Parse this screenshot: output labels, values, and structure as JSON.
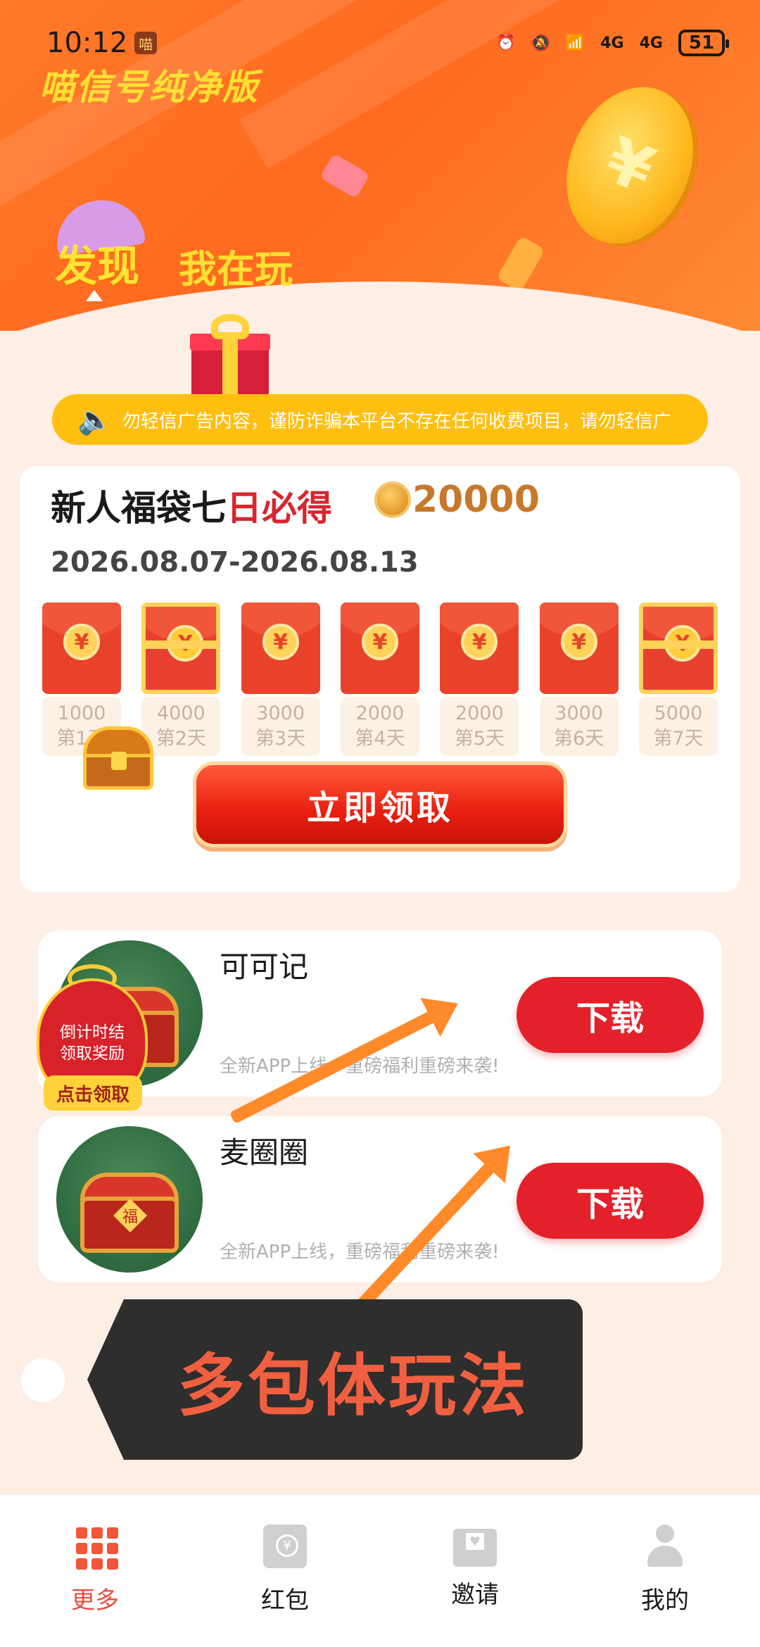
{
  "status_bar": {
    "time": "10:12",
    "signal_labels": [
      "4G",
      "4G"
    ],
    "battery": "51"
  },
  "app": {
    "title": "喵信号纯净版"
  },
  "tabs": [
    {
      "label": "发现",
      "active": true
    },
    {
      "label": "我在玩",
      "active": false
    }
  ],
  "notice": {
    "text": "勿轻信广告内容，谨防诈骗本平台不存在任何收费项目，请勿轻信广"
  },
  "welfare": {
    "title_black": "新人福袋七",
    "title_red": "日必得",
    "reward": "20000",
    "date_range": "2026.08.07-2026.08.13",
    "days": [
      {
        "amount": "1000",
        "label": "第1天",
        "special": false
      },
      {
        "amount": "4000",
        "label": "第2天",
        "special": true
      },
      {
        "amount": "3000",
        "label": "第3天",
        "special": false
      },
      {
        "amount": "2000",
        "label": "第4天",
        "special": false
      },
      {
        "amount": "2000",
        "label": "第5天",
        "special": false
      },
      {
        "amount": "3000",
        "label": "第6天",
        "special": false
      },
      {
        "amount": "5000",
        "label": "第7天",
        "special": true
      }
    ],
    "claim_label": "立即领取"
  },
  "apps": [
    {
      "name": "可可记",
      "desc": "全新APP上线，重磅福利重磅来袭!",
      "button": "下载"
    },
    {
      "name": "麦圈圈",
      "desc": "全新APP上线，重磅福利重磅来袭!",
      "button": "下载"
    }
  ],
  "countdown_bag": {
    "line1": "倒计时结",
    "line2": "领取奖励",
    "button": "点击领取"
  },
  "overlay": {
    "text": "多包体玩法"
  },
  "bottom_nav": [
    {
      "label": "更多",
      "icon": "grid-icon",
      "active": true
    },
    {
      "label": "红包",
      "icon": "red-envelope-icon",
      "active": false
    },
    {
      "label": "邀请",
      "icon": "invite-mail-icon",
      "active": false
    },
    {
      "label": "我的",
      "icon": "user-icon",
      "active": false
    }
  ],
  "colors": {
    "accent": "#ff6a1f",
    "brand_red": "#e4202a",
    "gold": "#ffbf10",
    "tab_yellow": "#ffe033"
  }
}
